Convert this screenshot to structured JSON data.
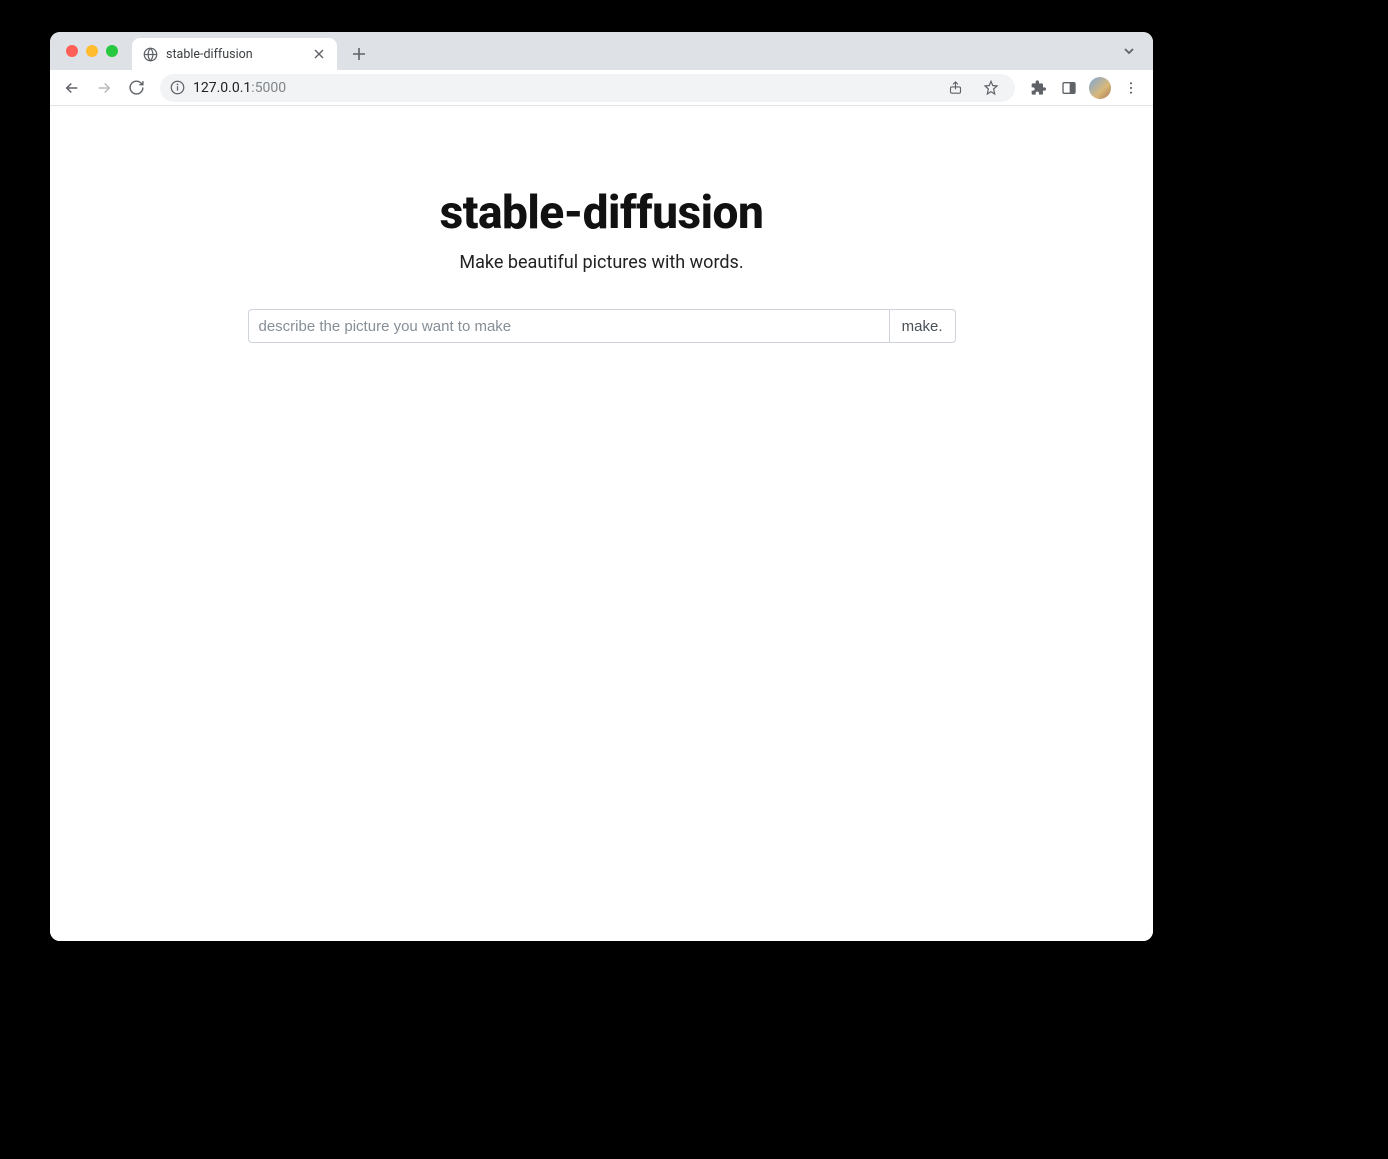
{
  "browser": {
    "tab": {
      "title": "stable-diffusion"
    },
    "url": {
      "host": "127.0.0.1",
      "port": ":5000"
    }
  },
  "page": {
    "heading": "stable-diffusion",
    "subtitle": "Make beautiful pictures with words.",
    "prompt": {
      "placeholder": "describe the picture you want to make",
      "value": ""
    },
    "make_button": "make."
  }
}
